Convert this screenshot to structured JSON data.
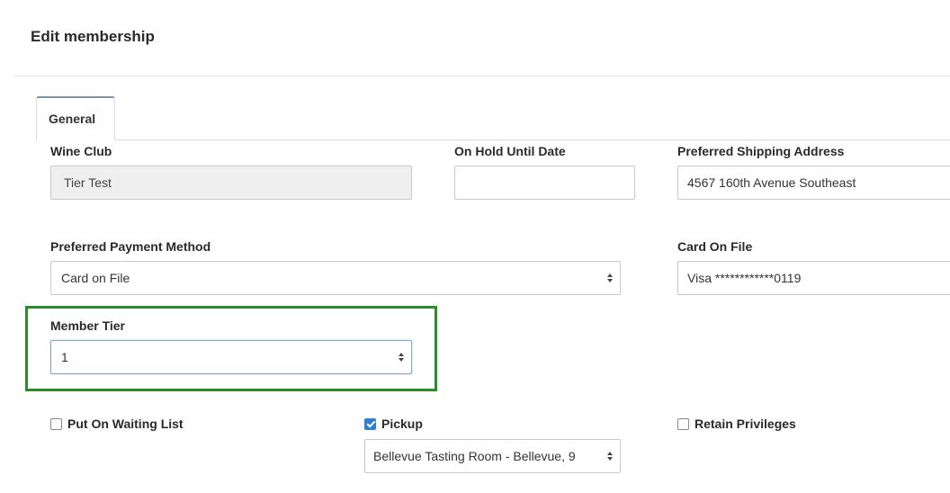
{
  "header": {
    "title": "Edit membership"
  },
  "tabs": [
    {
      "label": "General",
      "active": true
    }
  ],
  "form": {
    "wine_club": {
      "label": "Wine Club",
      "value": "Tier Test",
      "disabled": true
    },
    "on_hold_until_date": {
      "label": "On Hold Until Date",
      "value": ""
    },
    "preferred_shipping_address": {
      "label": "Preferred Shipping Address",
      "value": "4567 160th Avenue Southeast"
    },
    "preferred_payment_method": {
      "label": "Preferred Payment Method",
      "value": "Card on File"
    },
    "card_on_file": {
      "label": "Card On File",
      "value": "Visa ************0119"
    },
    "member_tier": {
      "label": "Member Tier",
      "value": "1"
    },
    "put_on_waiting_list": {
      "label": "Put On Waiting List",
      "checked": false
    },
    "pickup": {
      "label": "Pickup",
      "checked": true,
      "location": "Bellevue Tasting Room - Bellevue, 9"
    },
    "retain_privileges": {
      "label": "Retain Privileges",
      "checked": false
    }
  },
  "colors": {
    "highlight": "#2b8c2b",
    "checkbox_checked": "#2f7fd6",
    "tab_accent": "#7a93ad"
  }
}
